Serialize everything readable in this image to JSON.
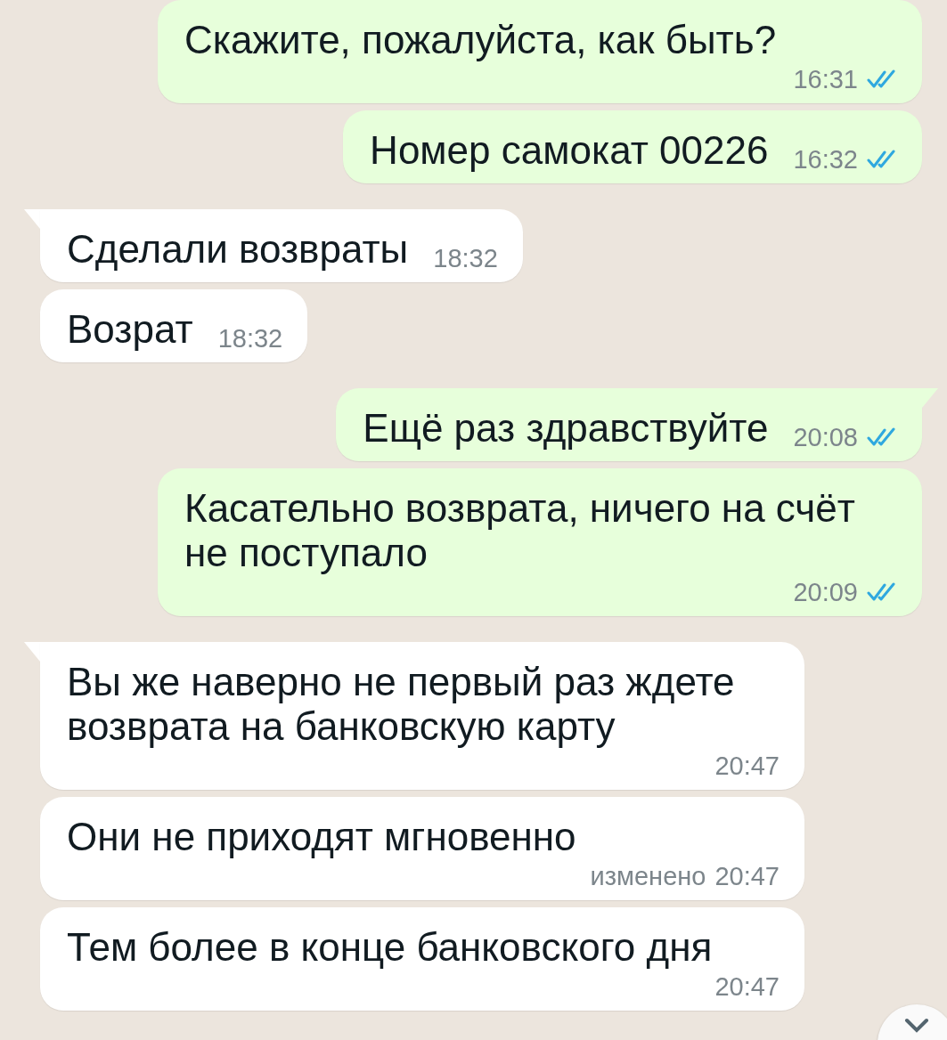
{
  "messages": [
    {
      "kind": "outgoing",
      "tail": false,
      "text": "Скажите, пожалуйста, как быть?",
      "time": "16:31",
      "read": true
    },
    {
      "kind": "outgoing",
      "tail": false,
      "text": "Номер самокат 00226",
      "time": "16:32",
      "read": true
    },
    {
      "kind": "incoming",
      "tail": true,
      "text": "Сделали возвраты",
      "time": "18:32"
    },
    {
      "kind": "incoming",
      "tail": false,
      "text": "Возрат",
      "time": "18:32"
    },
    {
      "kind": "outgoing",
      "tail": true,
      "text": "Ещё раз здравствуйте",
      "time": "20:08",
      "read": true
    },
    {
      "kind": "outgoing",
      "tail": false,
      "text": "Касательно возврата, ничего на счёт не поступало",
      "time": "20:09",
      "read": true
    },
    {
      "kind": "incoming",
      "tail": true,
      "text": "Вы же наверно не первый раз ждете возврата на банковскую карту",
      "time": "20:47"
    },
    {
      "kind": "incoming",
      "tail": false,
      "text": "Они не приходят мгновенно",
      "time": "20:47",
      "edited": "изменено"
    },
    {
      "kind": "incoming",
      "tail": false,
      "text": "Тем более в конце банковского дня",
      "time": "20:47"
    }
  ]
}
